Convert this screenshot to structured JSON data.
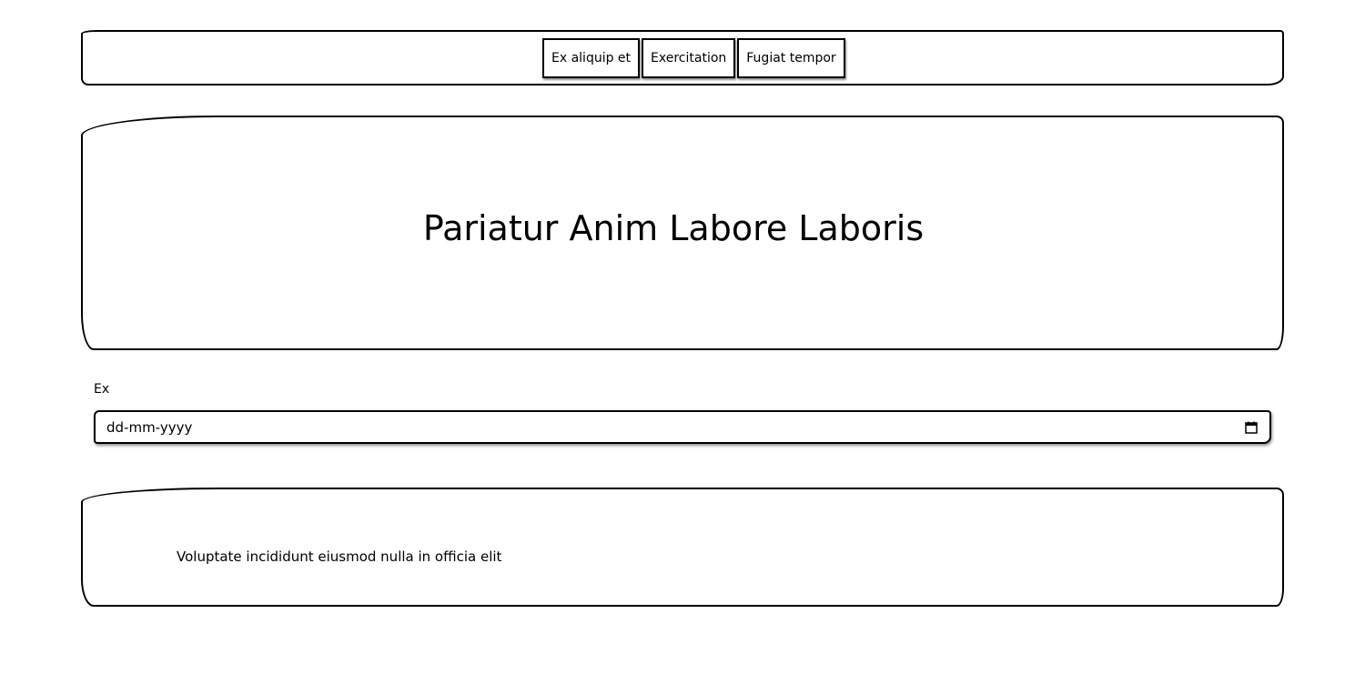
{
  "nav": {
    "items": [
      {
        "label": "Ex aliquip et"
      },
      {
        "label": "Exercitation"
      },
      {
        "label": "Fugiat tempor"
      }
    ]
  },
  "hero": {
    "title": "Pariatur Anim Labore Laboris"
  },
  "form": {
    "label": "Ex",
    "date_placeholder": "dd-mm-yyyy",
    "calendar_icon": "calendar-icon"
  },
  "footer": {
    "text": "Voluptate incididunt eiusmod nulla in officia elit"
  }
}
